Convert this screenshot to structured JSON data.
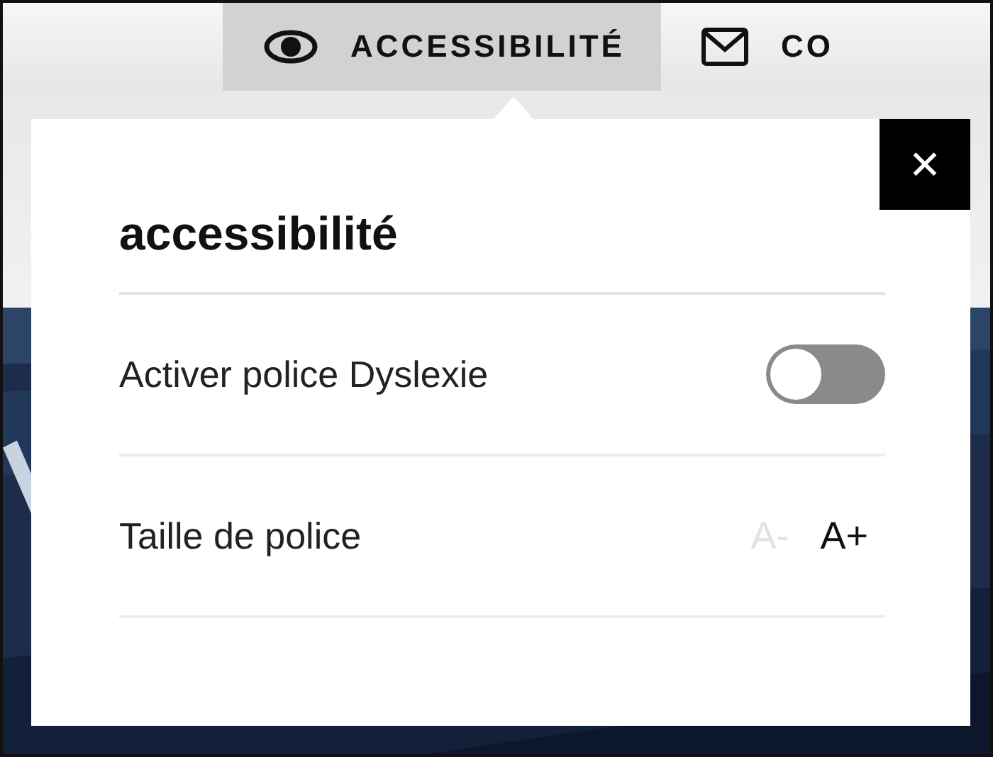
{
  "nav": {
    "items": [
      {
        "label": "ACCESSIBILITÉ",
        "selected": true
      },
      {
        "label": "CO",
        "selected": false
      }
    ]
  },
  "panel": {
    "title": "accessibilité",
    "close": "✕",
    "settings": [
      {
        "kind": "toggle",
        "label": "Activer police Dyslexie",
        "on": false
      },
      {
        "kind": "font_size",
        "label": "Taille de police",
        "buttons": [
          {
            "label": "A-",
            "disabled": true
          },
          {
            "label": "A+",
            "disabled": false
          }
        ]
      }
    ]
  }
}
